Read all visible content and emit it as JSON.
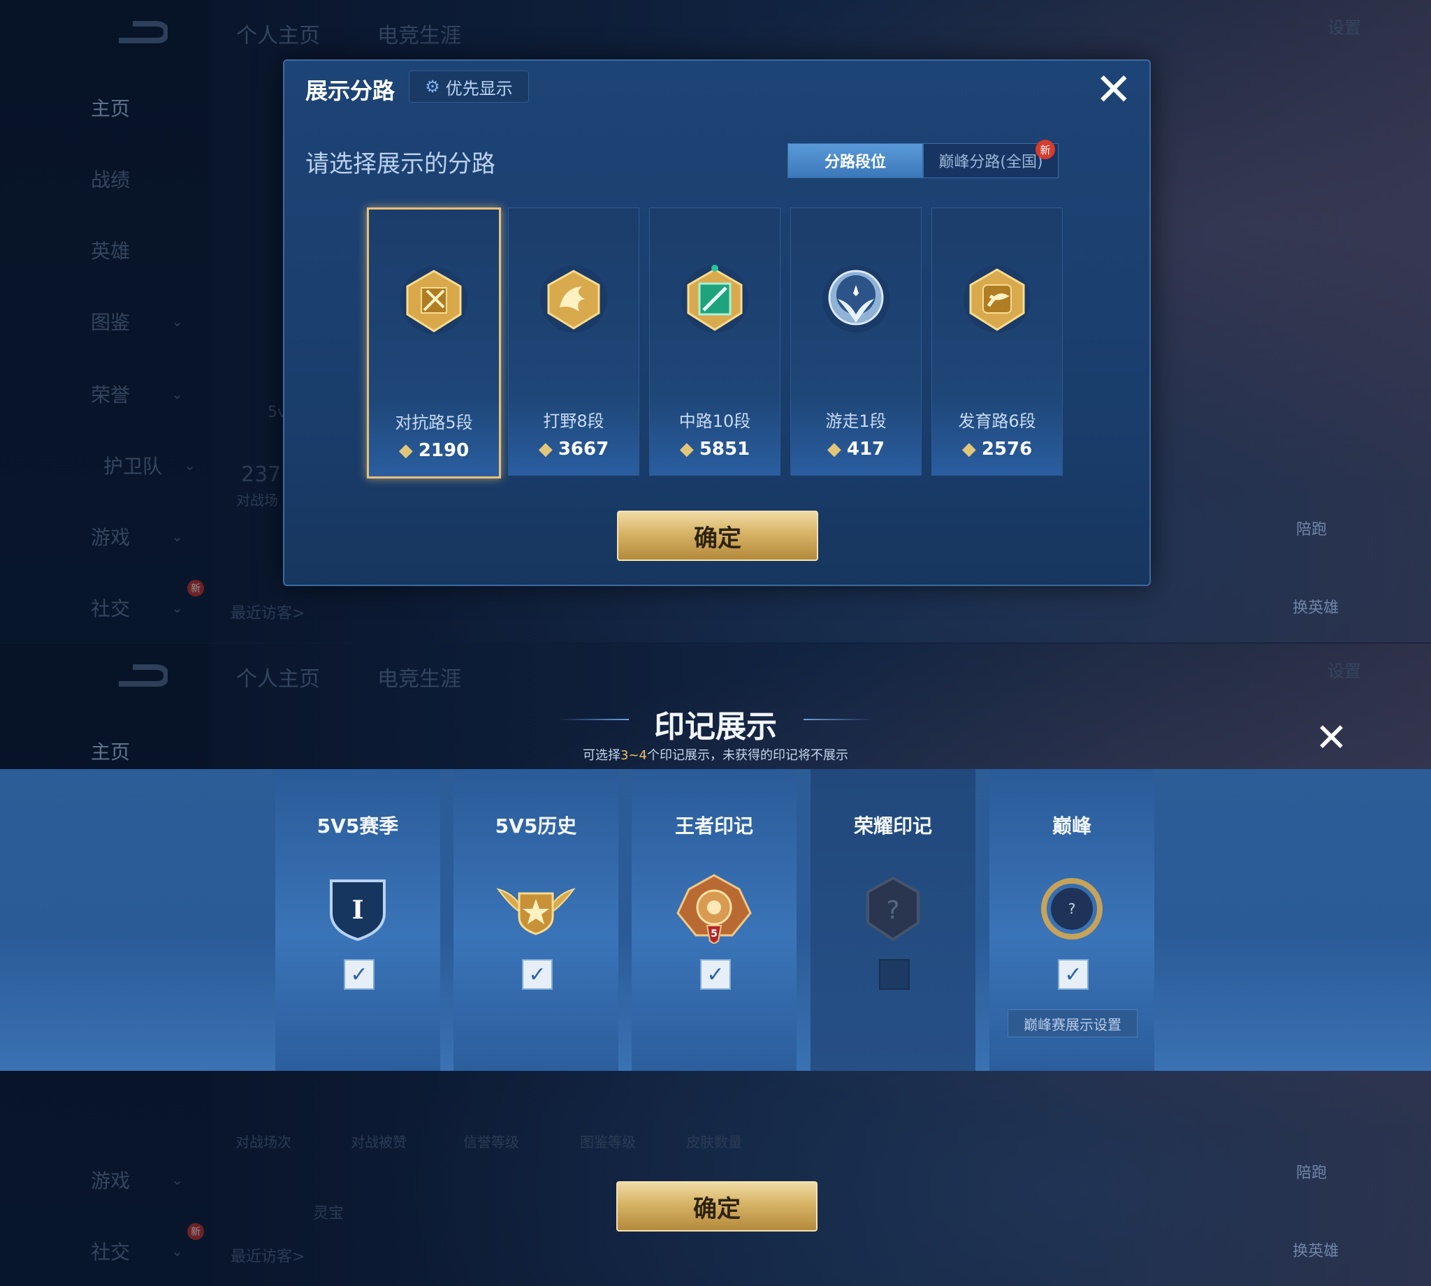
{
  "sidebar": {
    "items": [
      {
        "label": "主页"
      },
      {
        "label": "战绩"
      },
      {
        "label": "英雄"
      },
      {
        "label": "图鉴"
      },
      {
        "label": "荣誉"
      },
      {
        "label": "护卫队"
      },
      {
        "label": "游戏"
      },
      {
        "label": "社交"
      }
    ],
    "new_badge": "新"
  },
  "header": {
    "tabs": [
      {
        "label": "个人主页"
      },
      {
        "label": "电竞生涯"
      }
    ],
    "settings_label": "设置"
  },
  "background": {
    "stat_number": "237",
    "stat_label": "对战场",
    "visitors_label": "最近访客>",
    "lane_rank": "5v",
    "pet_name": "灵宝",
    "stats": [
      "对战场次",
      "对战被赞",
      "信誉等级",
      "图鉴等级",
      "皮肤数量"
    ]
  },
  "lane_dialog": {
    "title": "展示分路",
    "priority_label": "优先显示",
    "subtitle": "请选择展示的分路",
    "toggle": {
      "on": "分路段位",
      "off": "巅峰分路(全国)",
      "new_badge": "新"
    },
    "lanes": [
      {
        "name": "对抗路5段",
        "score": "2190",
        "selected": true,
        "emblem": "clash-lane-emblem"
      },
      {
        "name": "打野8段",
        "score": "3667",
        "selected": false,
        "emblem": "jungle-emblem"
      },
      {
        "name": "中路10段",
        "score": "5851",
        "selected": false,
        "emblem": "mid-lane-emblem"
      },
      {
        "name": "游走1段",
        "score": "417",
        "selected": false,
        "emblem": "roam-emblem"
      },
      {
        "name": "发育路6段",
        "score": "2576",
        "selected": false,
        "emblem": "farm-lane-emblem"
      }
    ],
    "confirm_label": "确定"
  },
  "mark_dialog": {
    "title": "印记展示",
    "note_prefix": "可选择",
    "note_highlight": "3~4",
    "note_suffix": "个印记展示，未获得的印记将不展示",
    "columns": [
      {
        "name": "5V5赛季",
        "checked": true,
        "icon": "season-shield-icon",
        "icon_text": "I"
      },
      {
        "name": "5V5历史",
        "checked": true,
        "icon": "winged-star-icon"
      },
      {
        "name": "王者印记",
        "checked": true,
        "icon": "king-mark-icon",
        "icon_text": "5"
      },
      {
        "name": "荣耀印记",
        "checked": false,
        "icon": "unknown-hex-icon",
        "icon_text": "?"
      },
      {
        "name": "巅峰",
        "checked": true,
        "icon": "peak-ring-icon",
        "icon_text": "?"
      }
    ],
    "peak_settings_label": "巅峰赛展示设置",
    "confirm_label": "确定"
  },
  "right_side": {
    "guard_label": "陪跑",
    "change_hero_label": "换英雄"
  },
  "colors": {
    "gold": "#e3c57a",
    "panel": "#1d4476",
    "highlight_text": "#f0c060"
  }
}
